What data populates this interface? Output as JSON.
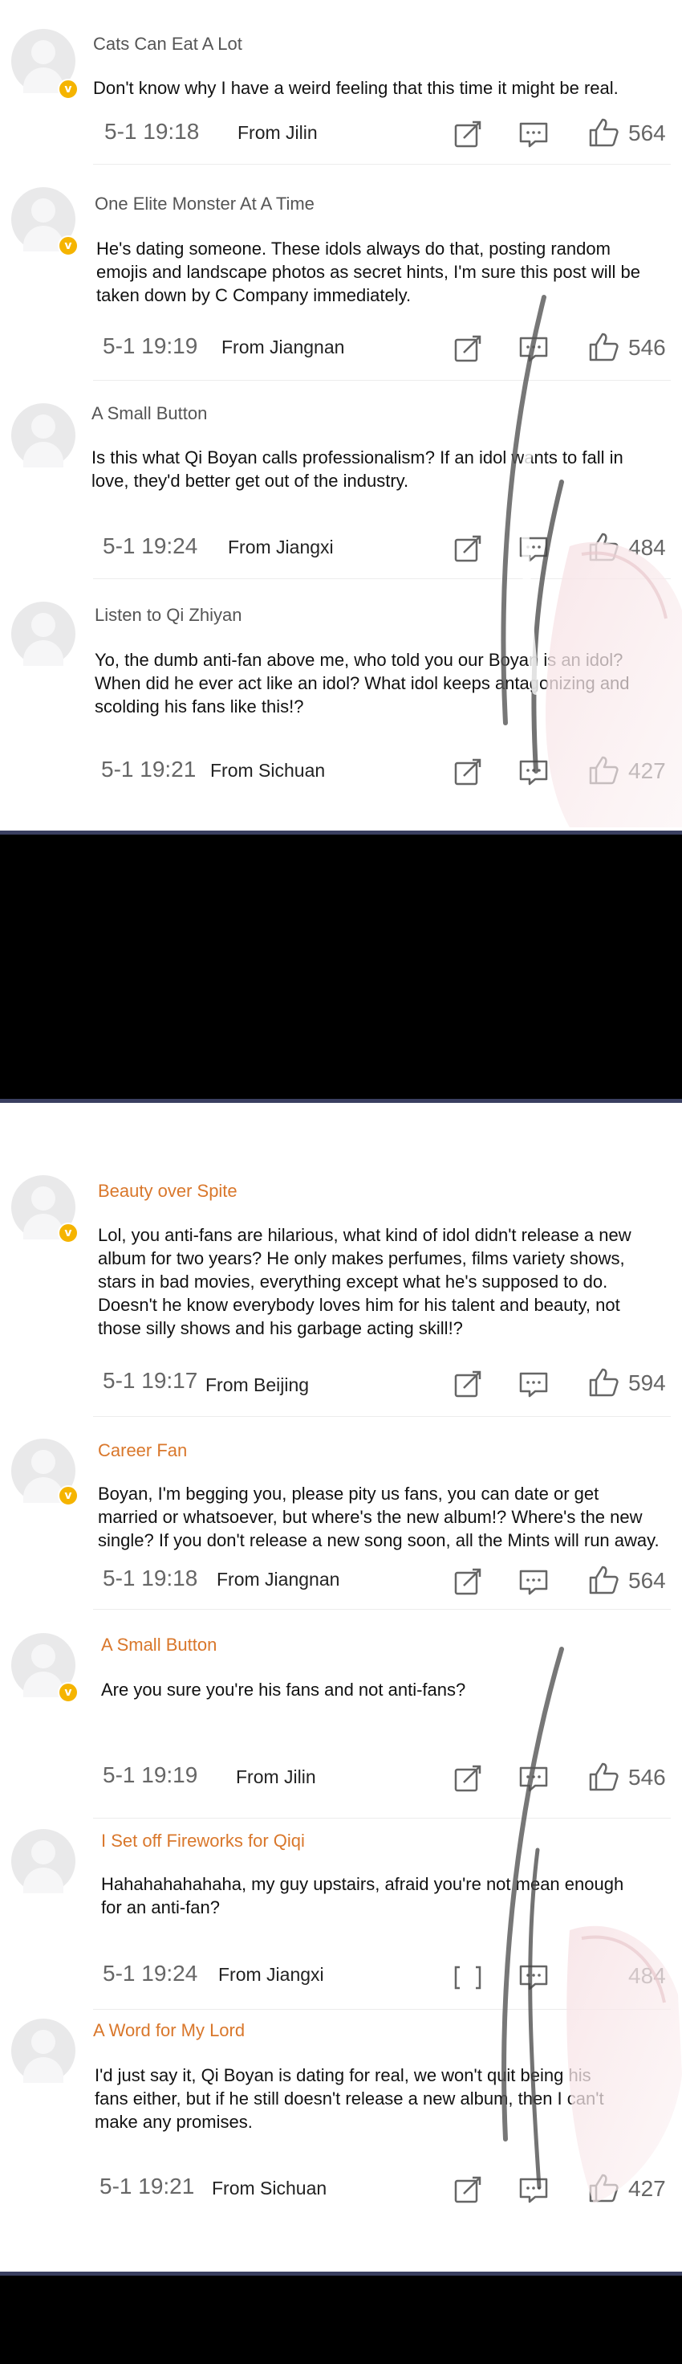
{
  "icons": {
    "share": "share-icon",
    "reply": "reply-icon",
    "like": "thumbs-up-icon",
    "verified": "verified-badge-icon"
  },
  "colors": {
    "username": "#555555",
    "username_orange": "#d9772b",
    "badge": "#f5b400",
    "separator": "#3a3f60"
  },
  "panel1": {
    "comments": [
      {
        "user": "Cats Can Eat A Lot",
        "text": "Don't know why I have a weird feeling that this time it might be real.",
        "time": "5-1 19:18",
        "location": "From Jilin",
        "likes": "564"
      },
      {
        "user": "One Elite Monster At A Time",
        "text": "He's dating someone. These idols always do that, posting random emojis and landscape photos as secret hints, I'm sure this post will be taken down by C Company immediately.",
        "time": "5-1 19:19",
        "location": "From Jiangnan",
        "likes": "546"
      },
      {
        "user": "A Small Button",
        "text": "Is this what Qi Boyan calls professionalism? If an idol wants to fall in love, they'd better get out of the industry.",
        "time": "5-1 19:24",
        "location": "From Jiangxi",
        "likes": "484"
      },
      {
        "user": "Listen to Qi Zhiyan",
        "text": "Yo, the dumb anti-fan above me, who told you our Boyan is an idol? When did he ever act like an idol? What idol keeps antagonizing and scolding his fans like this!?",
        "time": "5-1 19:21",
        "location": "From Sichuan",
        "likes": "427"
      }
    ]
  },
  "panel2": {
    "comments": [
      {
        "user": "Beauty over Spite",
        "text": "Lol, you anti-fans are hilarious, what kind of idol didn't release a new album for two years? He only makes perfumes, films variety shows, stars in bad movies, everything except what he's supposed to do. Doesn't he know everybody loves him for his talent and beauty, not those silly shows and his garbage acting skill!?",
        "time": "5-1 19:17",
        "location": "From Beijing",
        "likes": "594"
      },
      {
        "user": "Career Fan",
        "text": "Boyan, I'm begging you, please pity us fans, you can date or get married or whatsoever, but where's the new album!? Where's the new single? If you don't release a new song soon, all the Mints will run away.",
        "time": "5-1 19:18",
        "location": "From Jiangnan",
        "likes": "564"
      },
      {
        "user": "A Small Button",
        "text": "Are you sure you're his fans and not anti-fans?",
        "time": "5-1 19:19",
        "location": "From Jilin",
        "likes": "546"
      },
      {
        "user": "I Set off Fireworks for Qiqi",
        "text": "Hahahahahahaha, my guy upstairs, afraid you're not mean enough for an anti-fan?",
        "time": "5-1 19:24",
        "location": "From Jiangxi",
        "likes": "484"
      },
      {
        "user": "A Word for My Lord",
        "text": "I'd just say it, Qi Boyan is dating for real, we won't quit being his fans either, but if he still doesn't release a new album, then I can't make any promises.",
        "time": "5-1 19:21",
        "location": "From Sichuan",
        "likes": "427"
      }
    ]
  }
}
